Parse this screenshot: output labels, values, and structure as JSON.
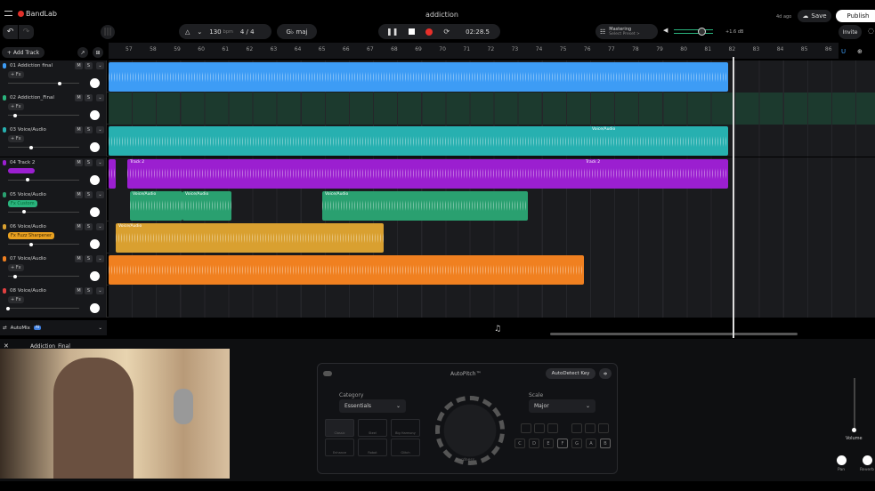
{
  "app": {
    "logo": "BandLab",
    "project_title": "addiction",
    "saved_ago": "4d ago",
    "save_label": "Save",
    "publish_label": "Publish",
    "invite_label": "Invite"
  },
  "transport": {
    "tempo": "130",
    "tempo_unit": "bpm",
    "time_signature": "4 / 4",
    "key": "G♭ maj",
    "time": "02:28.5"
  },
  "mastering": {
    "title": "Mastering",
    "preset": "Select Preset >",
    "gain": "+1.6 dB"
  },
  "toolbar": {
    "add_track": "+ Add Track"
  },
  "ruler": {
    "bars": [
      "57",
      "58",
      "59",
      "60",
      "61",
      "62",
      "63",
      "64",
      "65",
      "66",
      "67",
      "68",
      "69",
      "70",
      "71",
      "72",
      "73",
      "74",
      "75",
      "76",
      "77",
      "78",
      "79",
      "80",
      "81",
      "82",
      "83",
      "84",
      "85",
      "86"
    ]
  },
  "tracks": [
    {
      "name": "01 Addiction final",
      "fx": "+ Fx",
      "color": "#3d9cf5",
      "volume": 0.72
    },
    {
      "name": "02 Addiction_Final",
      "fx": "+ Fx",
      "color": "#2ab37d",
      "volume": 0.1
    },
    {
      "name": "03 Voice/Audio",
      "fx": "+ Fx",
      "color": "#27b0b0",
      "volume": 0.32
    },
    {
      "name": "04 Track 2",
      "fx": "",
      "color": "#9b1fd0",
      "volume": 0.28
    },
    {
      "name": "05 Voice/Audio",
      "fx": "Fx Custom",
      "color": "#2aa070",
      "volume": 0.22
    },
    {
      "name": "06 Voice/Audio",
      "fx": "Fx Fuzz Sharpener",
      "color": "#d9a030",
      "volume": 0.32
    },
    {
      "name": "07 Voice/Audio",
      "fx": "+ Fx",
      "color": "#f08020",
      "volume": 0.1
    },
    {
      "name": "08 Voice/Audio",
      "fx": "+ Fx",
      "color": "#e04040",
      "volume": 0.0
    }
  ],
  "ms": {
    "mute": "M",
    "solo": "S"
  },
  "clips": {
    "voice": "Voice/Audio",
    "track2": "Track 2",
    "region": "Voice/Audio"
  },
  "automix": {
    "label": "AutoMix",
    "badge": "AI"
  },
  "selected_track": "Addiction_Final",
  "autopitch": {
    "title": "AutoPitch™",
    "autodetect": "AutoDetect Key",
    "category_label": "Category",
    "category_value": "Essentials",
    "scale_label": "Scale",
    "scale_value": "Major",
    "knob_label": "Hardness",
    "presets": [
      "Classic",
      "Steel",
      "Big Harmony",
      "Enhance",
      "Robot",
      "Glitch"
    ],
    "keys": [
      "C",
      "D",
      "E",
      "F",
      "G",
      "A",
      "B"
    ]
  },
  "mixer": {
    "volume_label": "Volume",
    "pan_label": "Pan",
    "reverb_label": "Reverb"
  }
}
